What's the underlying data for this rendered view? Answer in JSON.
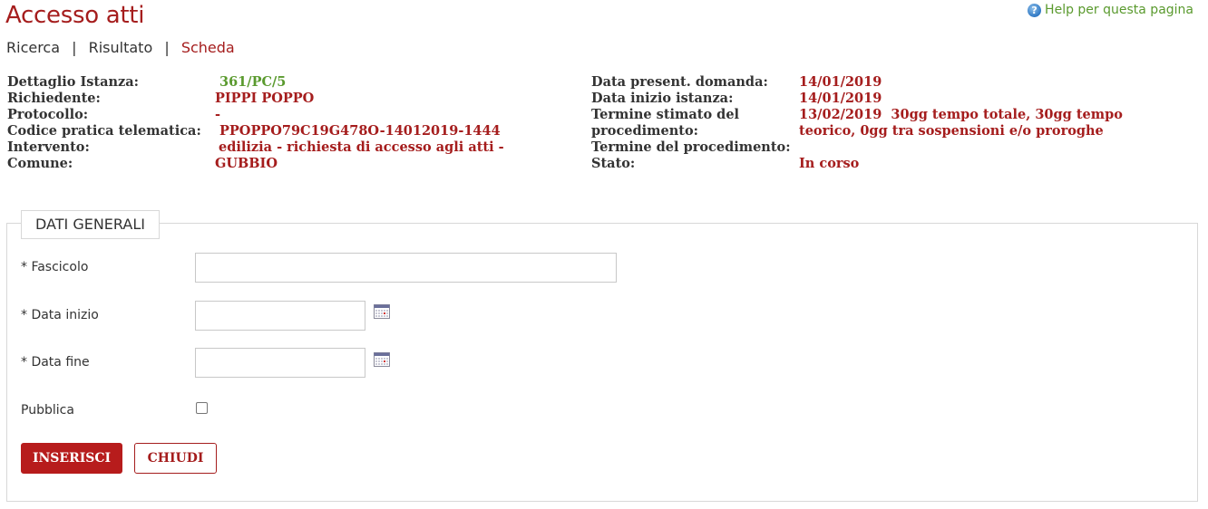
{
  "page": {
    "title": "Accesso atti",
    "help_label": "Help per questa pagina"
  },
  "breadcrumb": {
    "items": [
      "Ricerca",
      "Risultato",
      "Scheda"
    ],
    "separator": "|"
  },
  "details_left": [
    {
      "label": "Dettaglio Istanza:",
      "value": "361/PC/5"
    },
    {
      "label": "Richiedente:",
      "value": "PIPPI POPPO"
    },
    {
      "label": "Protocollo:",
      "value": "-"
    },
    {
      "label": "Codice pratica telematica:",
      "value": "PPOPPO79C19G478O-14012019-1444"
    },
    {
      "label": "Intervento:",
      "value": "edilizia - richiesta di accesso agli atti -"
    },
    {
      "label": "Comune:",
      "value": "GUBBIO"
    }
  ],
  "details_right": {
    "data_presentazione": {
      "label": "Data present. domanda:",
      "value": "14/01/2019"
    },
    "data_inizio": {
      "label": "Data inizio istanza:",
      "value": "14/01/2019"
    },
    "termine_stimato": {
      "label_line1": "Termine stimato del",
      "label_line2": "procedimento:",
      "value_line1": "13/02/2019  30gg tempo totale, 30gg tempo",
      "value_line2": "teorico, 0gg tra sospensioni e/o proroghe"
    },
    "termine_procedimento": {
      "label": "Termine del procedimento:",
      "value": ""
    },
    "stato": {
      "label": "Stato:",
      "value": "In corso"
    }
  },
  "form": {
    "legend": "DATI GENERALI",
    "fields": {
      "fascicolo": {
        "label": "* Fascicolo",
        "value": ""
      },
      "data_inizio": {
        "label": "* Data inizio",
        "value": ""
      },
      "data_fine": {
        "label": "* Data fine",
        "value": ""
      },
      "pubblica": {
        "label": "Pubblica",
        "checked": false
      }
    },
    "buttons": {
      "insert": "INSERISCI",
      "close": "CHIUDI"
    }
  },
  "colors": {
    "accent": "#a51d1d",
    "button_primary": "#b71c1c",
    "green": "#5a9a2e"
  }
}
